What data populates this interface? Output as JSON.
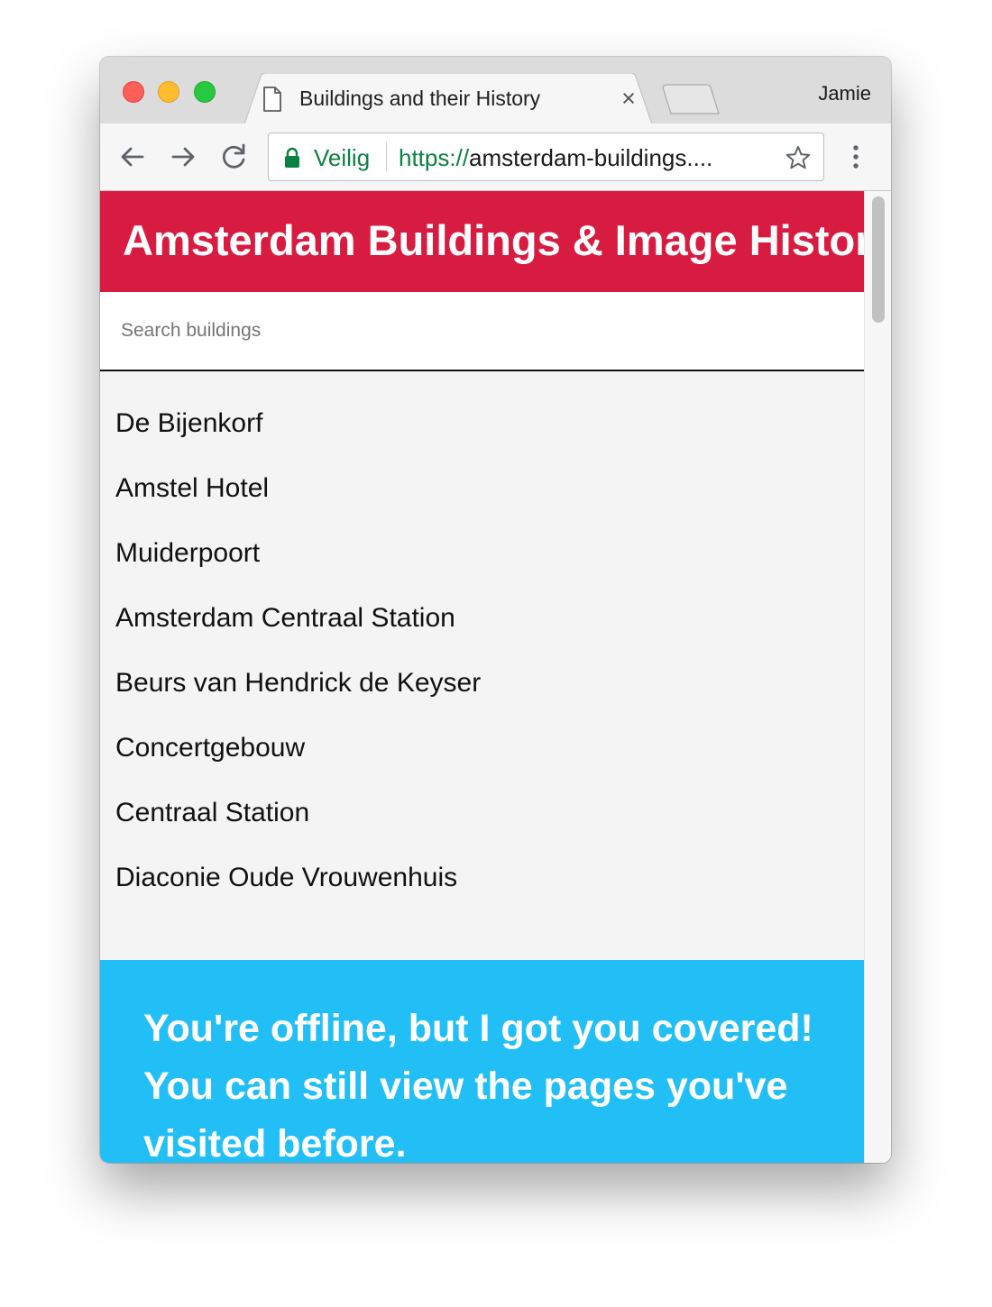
{
  "browser": {
    "tab": {
      "title": "Buildings and their History",
      "close_glyph": "×"
    },
    "profile_name": "Jamie",
    "omnibox": {
      "secure_label": "Veilig",
      "url_scheme": "https://",
      "url_rest": "amsterdam-buildings...."
    },
    "icons": {
      "tab_icon": "document-icon",
      "back": "arrow-left-icon",
      "forward": "arrow-right-icon",
      "reload": "reload-icon",
      "lock": "lock-icon",
      "bookmark": "star-icon",
      "menu": "kebab-menu-icon"
    }
  },
  "page": {
    "header": {
      "title": "Amsterdam Buildings & Image History"
    },
    "search": {
      "placeholder": "Search buildings",
      "value": ""
    },
    "buildings": [
      "De Bijenkorf",
      "Amstel Hotel",
      "Muiderpoort",
      "Amsterdam Centraal Station",
      "Beurs van Hendrick de Keyser",
      "Concertgebouw",
      "Centraal Station",
      "Diaconie Oude Vrouwenhuis"
    ],
    "offline_banner": {
      "message": "You're offline, but I got you covered! You can still view the pages you've visited before."
    }
  },
  "colors": {
    "header_bg": "#d81b41",
    "banner_bg": "#22bff6",
    "secure_green": "#0b8043",
    "page_bg": "#f4f4f4"
  }
}
